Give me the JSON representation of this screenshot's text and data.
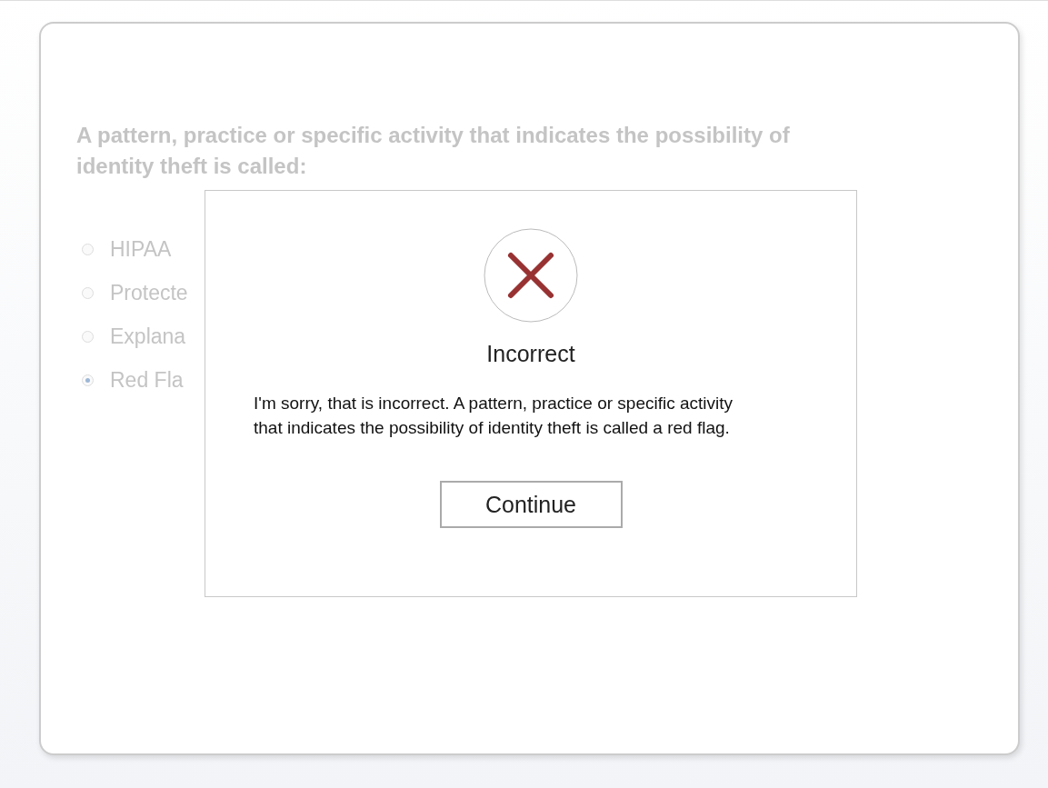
{
  "question": {
    "text": "A pattern, practice or specific activity that indicates the possibility of identity theft is called:",
    "options": [
      {
        "label": "HIPAA",
        "selected": false
      },
      {
        "label": "Protecte",
        "selected": false
      },
      {
        "label": "Explana",
        "selected": false
      },
      {
        "label": "Red Fla",
        "selected": true
      }
    ]
  },
  "dialog": {
    "title": "Incorrect",
    "message": "I'm sorry, that is incorrect. A pattern, practice or specific activity that indicates the possibility of identity theft is called a red flag.",
    "button": "Continue"
  }
}
